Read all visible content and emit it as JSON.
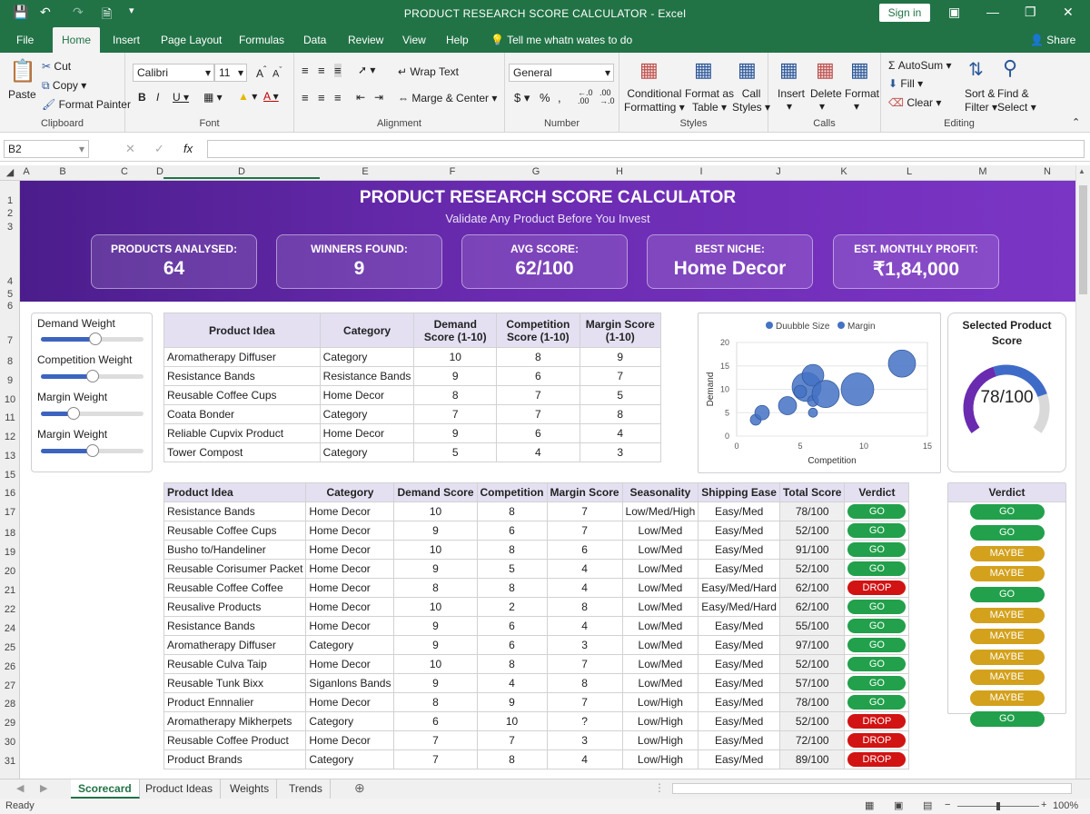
{
  "window": {
    "title": "PRODUCT RESEARCH SCORE CALCULATOR  -  Excel",
    "sign_in": "Sign in"
  },
  "menu": [
    "File",
    "Home",
    "Insert",
    "Page Layout",
    "Formulas",
    "Data",
    "Review",
    "View",
    "Help"
  ],
  "tell_me": "Tell me whatn wates to do",
  "share": "Share",
  "ribbon": {
    "clipboard": {
      "paste": "Paste",
      "cut": "Cut",
      "copy": "Copy",
      "format_painter": "Format Painter",
      "label": "Clipboard"
    },
    "font": {
      "name": "Calibri",
      "size": "11",
      "label": "Font"
    },
    "alignment": {
      "wrap": "Wrap Text",
      "merge": "Marge & Center",
      "label": "Alignment"
    },
    "number": {
      "format": "General",
      "label": "Number"
    },
    "styles": {
      "cond1": "Conditional",
      "cond2": "Formatting",
      "fmt1": "Format as",
      "fmt2": "Table",
      "cell1": "Call",
      "cell2": "Styles",
      "label": "Styles"
    },
    "cells": {
      "insert": "Insert",
      "delete": "Delete",
      "format": "Format",
      "label": "Calls"
    },
    "editing": {
      "autosum": "AutoSum",
      "fill": "Fill",
      "clear": "Clear",
      "sort1": "Sort &",
      "sort2": "Filter",
      "find1": "Find &",
      "find2": "Select",
      "label": "Editing"
    }
  },
  "formula_bar": {
    "name_box": "B2",
    "formula": ""
  },
  "columns": [
    "A",
    "B",
    "C",
    "D",
    "D",
    "E",
    "F",
    "G",
    "H",
    "I",
    "J",
    "K",
    "L",
    "M",
    "N"
  ],
  "rows": [
    "1",
    "2",
    "3",
    "4",
    "5",
    "6",
    "7",
    "8",
    "9",
    "10",
    "11",
    "12",
    "13",
    "15",
    "16",
    "17",
    "18",
    "19",
    "20",
    "21",
    "22",
    "24",
    "25",
    "26",
    "27",
    "28",
    "29",
    "30",
    "31"
  ],
  "banner": {
    "title": "PRODUCT RESEARCH SCORE CALCULATOR",
    "subtitle": "Validate Any Product Before You Invest",
    "kpis": [
      {
        "label": "PRODUCTS ANALYSED:",
        "value": "64"
      },
      {
        "label": "WINNERS FOUND:",
        "value": "9"
      },
      {
        "label": "AVG SCORE:",
        "value": "62/100"
      },
      {
        "label": "BEST NICHE:",
        "value": "Home Decor"
      },
      {
        "label": "EST. MONTHLY PROFIT:",
        "value": "₹1,84,000"
      }
    ]
  },
  "sliders": [
    {
      "label": "Demand Weight",
      "value": 0.53
    },
    {
      "label": "Competition Weight",
      "value": 0.5
    },
    {
      "label": "Margin Weight",
      "value": 0.32
    },
    {
      "label": "Margin Weight",
      "value": 0.5
    }
  ],
  "table1": {
    "headers": [
      "Product Idea",
      "Category",
      "Demand Score (1-10)",
      "Competition Score (1-10)",
      "Margin Score (1-10)"
    ],
    "rows": [
      [
        "Aromatherapy Diffuser",
        "Category",
        "10",
        "8",
        "9"
      ],
      [
        "Resistance Bands",
        "Resistance Bands",
        "9",
        "6",
        "7"
      ],
      [
        "Reusable Coffee Cups",
        "Home Decor",
        "8",
        "7",
        "5"
      ],
      [
        "Coata Bonder",
        "Category",
        "7",
        "7",
        "8"
      ],
      [
        "Reliable Cupvix Product",
        "Home Decor",
        "9",
        "6",
        "4"
      ],
      [
        "Tower Compost",
        "Category",
        "5",
        "4",
        "3"
      ]
    ]
  },
  "chart_data": {
    "type": "scatter",
    "legend": [
      "Duubble Size",
      "Margin"
    ],
    "xlabel": "Competition",
    "ylabel": "Demand",
    "xlim": [
      0,
      15
    ],
    "ylim": [
      0,
      20
    ],
    "xticks": [
      "0",
      "5",
      "10",
      "15"
    ],
    "yticks": [
      "0",
      "5",
      "10",
      "15",
      "20"
    ],
    "points": [
      {
        "x": 1.5,
        "y": 3.5,
        "size": 6
      },
      {
        "x": 2,
        "y": 5,
        "size": 8
      },
      {
        "x": 4,
        "y": 6.5,
        "size": 10
      },
      {
        "x": 5.5,
        "y": 10.5,
        "size": 16
      },
      {
        "x": 6,
        "y": 13,
        "size": 12
      },
      {
        "x": 5,
        "y": 9.5,
        "size": 7
      },
      {
        "x": 6,
        "y": 7.5,
        "size": 6
      },
      {
        "x": 6,
        "y": 5,
        "size": 5
      },
      {
        "x": 7,
        "y": 9,
        "size": 15
      },
      {
        "x": 9.5,
        "y": 10,
        "size": 18
      },
      {
        "x": 13,
        "y": 15.5,
        "size": 15
      }
    ],
    "color": "#4472c4"
  },
  "gauge": {
    "title": "Selected Product Score",
    "value_text": "78/100",
    "value": 0.78
  },
  "table2": {
    "headers": [
      "Product Idea",
      "Category",
      "Demand Score",
      "Competition",
      "Margin Score",
      "Seasonality",
      "Shipping Ease",
      "Total Score",
      "Verdict"
    ],
    "rows": [
      [
        "Resistance Bands",
        "Home Decor",
        "10",
        "8",
        "7",
        "Low/Med/High",
        "Easy/Med",
        "78/100",
        "GO"
      ],
      [
        "Reusable Coffee Cups",
        "Home Decor",
        "9",
        "6",
        "7",
        "Low/Med",
        "Easy/Med",
        "52/100",
        "GO"
      ],
      [
        "Busho to/Handeliner",
        "Home Decor",
        "10",
        "8",
        "6",
        "Low/Med",
        "Easy/Med",
        "91/100",
        "GO"
      ],
      [
        "Reusable Corisumer Packet",
        "Home Decor",
        "9",
        "5",
        "4",
        "Low/Med",
        "Easy/Med",
        "52/100",
        "GO"
      ],
      [
        "Reusable Coffee Coffee",
        "Home Decor",
        "8",
        "8",
        "4",
        "Low/Med",
        "Easy/Med/Hard",
        "62/100",
        "DROP"
      ],
      [
        "Reusalive Products",
        "Home Decor",
        "10",
        "2",
        "8",
        "Low/Med",
        "Easy/Med/Hard",
        "62/100",
        "GO"
      ],
      [
        "Resistance Bands",
        "Home Decor",
        "9",
        "6",
        "4",
        "Low/Med",
        "Easy/Med",
        "55/100",
        "GO"
      ],
      [
        "Aromatherapy Diffuser",
        "Category",
        "9",
        "6",
        "3",
        "Low/Med",
        "Easy/Med",
        "97/100",
        "GO"
      ],
      [
        "Reusable Culva Taip",
        "Home Decor",
        "10",
        "8",
        "7",
        "Low/Med",
        "Easy/Med",
        "52/100",
        "GO"
      ],
      [
        "Reusable Tunk Bixx",
        "Siganlons Bands",
        "9",
        "4",
        "8",
        "Low/Med",
        "Easy/Med",
        "57/100",
        "GO"
      ],
      [
        "Product Ennnalier",
        "Home Decor",
        "8",
        "9",
        "7",
        "Low/High",
        "Easy/Med",
        "78/100",
        "GO"
      ],
      [
        "Aromatherapy Mikherpets",
        "Category",
        "6",
        "10",
        "?",
        "Low/High",
        "Easy/Med",
        "52/100",
        "DROP"
      ],
      [
        "Reusable Coffee Product",
        "Home Decor",
        "7",
        "7",
        "3",
        "Low/High",
        "Easy/Med",
        "72/100",
        "DROP"
      ],
      [
        "Product Brands",
        "Category",
        "7",
        "8",
        "4",
        "Low/High",
        "Easy/Med",
        "89/100",
        "DROP"
      ]
    ]
  },
  "side_verdict": {
    "header": "Verdict",
    "values": [
      "GO",
      "GO",
      "MAYBE",
      "MAYBE",
      "GO",
      "MAYBE",
      "MAYBE",
      "MAYBE",
      "MAYBE",
      "MAYBE",
      "GO"
    ]
  },
  "sheet_tabs": [
    "Scorecard",
    "Product Ideas",
    "Weights",
    "Trends"
  ],
  "status": {
    "left": "Ready",
    "zoom": "100%"
  }
}
